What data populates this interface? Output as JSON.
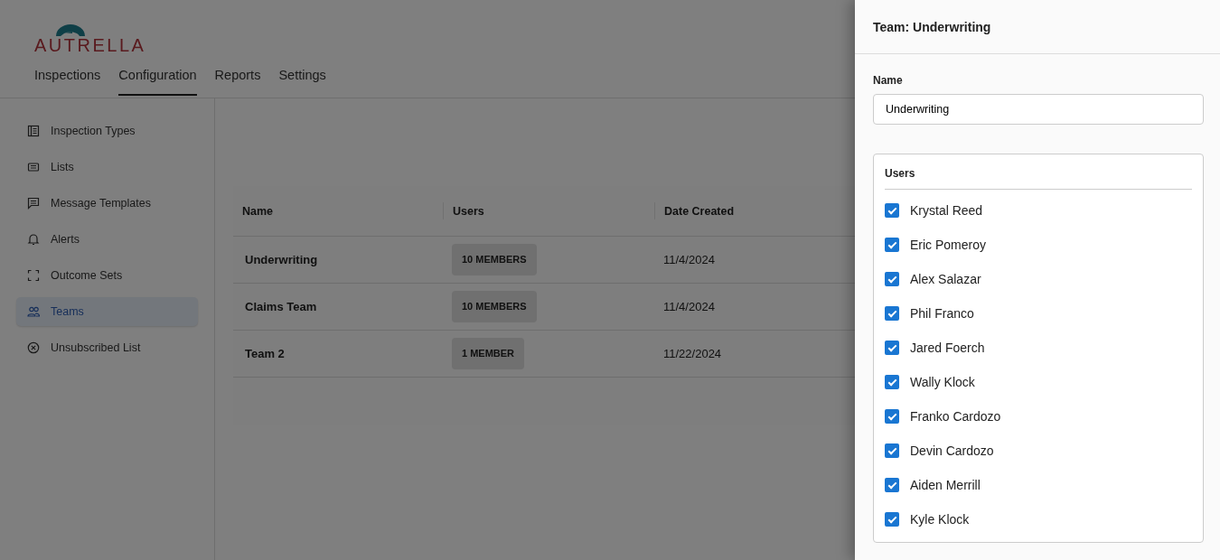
{
  "logo": {
    "text": "AUTRELLA"
  },
  "nav_tabs": [
    {
      "label": "Inspections",
      "selected": false
    },
    {
      "label": "Configuration",
      "selected": true
    },
    {
      "label": "Reports",
      "selected": false
    },
    {
      "label": "Settings",
      "selected": false
    }
  ],
  "sidebar": {
    "items": [
      {
        "label": "Inspection Types",
        "selected": false
      },
      {
        "label": "Lists",
        "selected": false
      },
      {
        "label": "Message Templates",
        "selected": false
      },
      {
        "label": "Alerts",
        "selected": false
      },
      {
        "label": "Outcome Sets",
        "selected": false
      },
      {
        "label": "Teams",
        "selected": true
      },
      {
        "label": "Unsubscribed List",
        "selected": false
      }
    ]
  },
  "table": {
    "columns": [
      "Name",
      "Users",
      "Date Created"
    ],
    "rows": [
      {
        "name": "Underwriting",
        "users": "10 MEMBERS",
        "date_created": "11/4/2024"
      },
      {
        "name": "Claims Team",
        "users": "10 MEMBERS",
        "date_created": "11/4/2024"
      },
      {
        "name": "Team 2",
        "users": "1 MEMBER",
        "date_created": "11/22/2024"
      }
    ]
  },
  "drawer": {
    "title": "Team: Underwriting",
    "name_field": {
      "label": "Name",
      "value": "Underwriting"
    },
    "users": {
      "label": "Users",
      "items": [
        {
          "name": "Krystal Reed",
          "checked": true
        },
        {
          "name": "Eric Pomeroy",
          "checked": true
        },
        {
          "name": "Alex Salazar",
          "checked": true
        },
        {
          "name": "Phil Franco",
          "checked": true
        },
        {
          "name": "Jared Foerch",
          "checked": true
        },
        {
          "name": "Wally Klock",
          "checked": true
        },
        {
          "name": "Franko Cardozo",
          "checked": true
        },
        {
          "name": "Devin Cardozo",
          "checked": true
        },
        {
          "name": "Aiden Merrill",
          "checked": true
        },
        {
          "name": "Kyle Klock",
          "checked": true
        }
      ]
    }
  }
}
